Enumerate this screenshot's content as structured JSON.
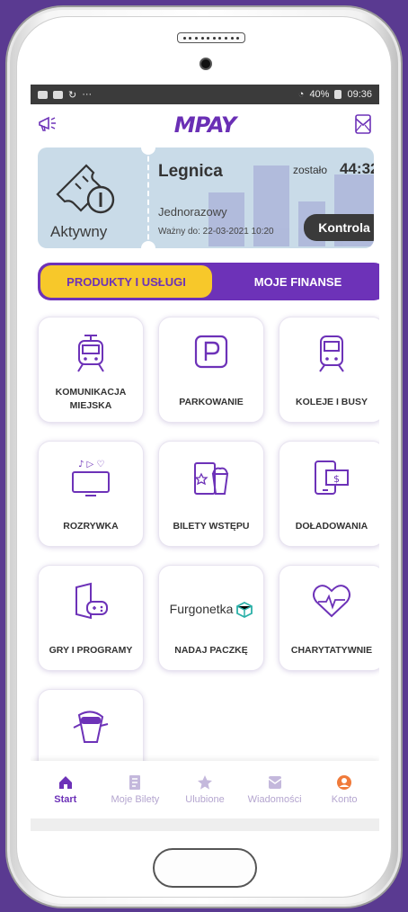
{
  "statusbar": {
    "dots": "···",
    "signal": "40%",
    "time": "09:36"
  },
  "header": {
    "logo": "MPAY",
    "left_icon": "megaphone-icon",
    "right_icon": "envelope-icon"
  },
  "ticket": {
    "city": "Legnica",
    "remaining_label": "zostało",
    "timer": "44:32",
    "type": "Jednorazowy",
    "valid": "Ważny do: 22-03-2021 10:20",
    "status": "Aktywny",
    "button": "Kontrola"
  },
  "tabs": [
    {
      "label": "PRODUKTY I USŁUGI",
      "active": true
    },
    {
      "label": "MOJE FINANSE",
      "active": false
    }
  ],
  "tiles": [
    {
      "label": "KOMUNIKACJA MIEJSKA",
      "icon": "tram-icon"
    },
    {
      "label": "PARKOWANIE",
      "icon": "parking-icon"
    },
    {
      "label": "KOLEJE I BUSY",
      "icon": "train-icon"
    },
    {
      "label": "ROZRYWKA",
      "icon": "tv-icon"
    },
    {
      "label": "BILETY WSTĘPU",
      "icon": "ticket-popcorn-icon"
    },
    {
      "label": "DOŁADOWANIA",
      "icon": "phone-topup-icon"
    },
    {
      "label": "GRY I PROGRAMY",
      "icon": "game-icon"
    },
    {
      "label": "NADAJ PACZKĘ",
      "icon": "furgonetka-logo",
      "brand": "Furgonetka"
    },
    {
      "label": "CHARYTATYWNIE",
      "icon": "heart-icon"
    }
  ],
  "bottom_nav": [
    {
      "label": "Start",
      "icon": "home-icon",
      "active": true
    },
    {
      "label": "Moje Bilety",
      "icon": "tickets-icon",
      "active": false
    },
    {
      "label": "Ulubione",
      "icon": "star-icon",
      "active": false
    },
    {
      "label": "Wiadomości",
      "icon": "envelope-icon",
      "active": false
    },
    {
      "label": "Konto",
      "icon": "user-icon",
      "active": false
    }
  ],
  "colors": {
    "accent": "#6d32b8",
    "tab_active": "#f7c82a",
    "ticket_bg": "#c9dbe8",
    "account": "#f07a3a"
  }
}
